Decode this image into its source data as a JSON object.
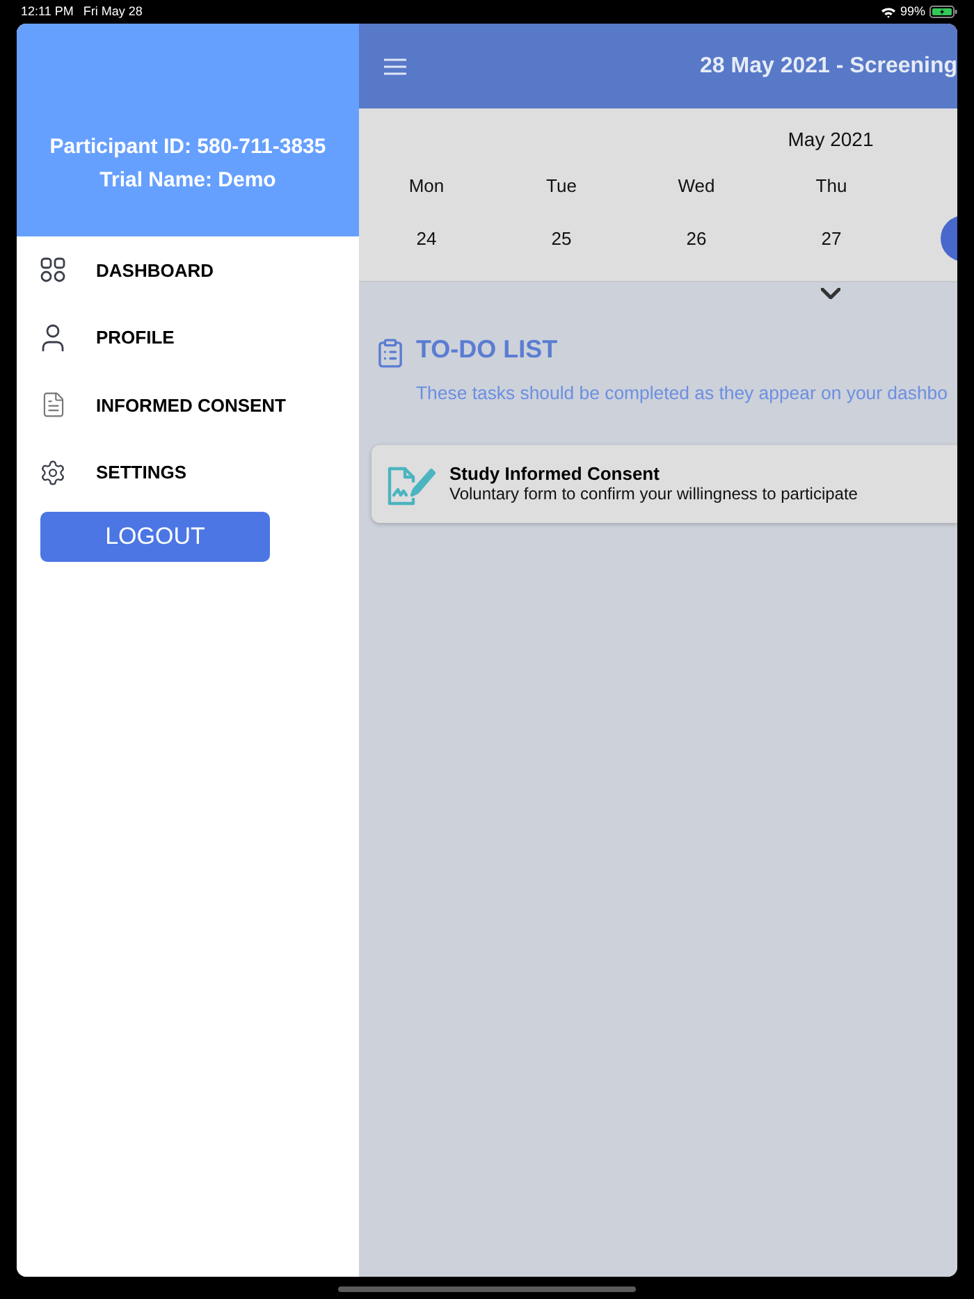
{
  "status_bar": {
    "time": "12:11 PM",
    "date": "Fri May 28",
    "battery": "99%"
  },
  "drawer": {
    "participant": "Participant ID: 580-711-3835",
    "trial": "Trial Name: Demo",
    "items": [
      {
        "label": "DASHBOARD"
      },
      {
        "label": "PROFILE"
      },
      {
        "label": "INFORMED CONSENT"
      },
      {
        "label": "SETTINGS"
      }
    ],
    "logout": "LOGOUT"
  },
  "header": {
    "title": "28 May 2021 - Screening"
  },
  "calendar": {
    "month": "May 2021",
    "days": [
      {
        "weekday": "Mon",
        "date": "24",
        "selected": false
      },
      {
        "weekday": "Tue",
        "date": "25",
        "selected": false
      },
      {
        "weekday": "Wed",
        "date": "26",
        "selected": false
      },
      {
        "weekday": "Thu",
        "date": "27",
        "selected": false
      },
      {
        "selected": true
      }
    ]
  },
  "todo": {
    "title": "TO-DO LIST",
    "subtitle": "These tasks should be completed as they appear on your dashbo",
    "tasks": [
      {
        "title": "Study Informed Consent",
        "description": "Voluntary form to confirm your willingness to participate"
      }
    ]
  }
}
